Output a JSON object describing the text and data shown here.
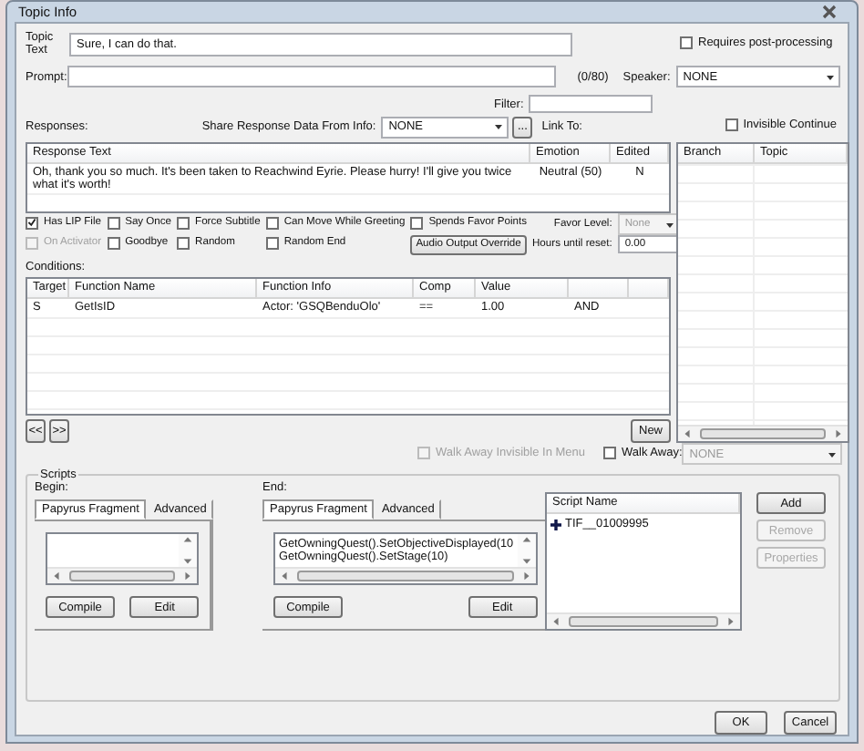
{
  "window": {
    "title": "Topic Info"
  },
  "topic_text": {
    "label": "Topic Text",
    "value": "Sure, I can do that."
  },
  "requires_post_processing": {
    "label": "Requires post-processing",
    "checked": false
  },
  "prompt": {
    "label": "Prompt:",
    "counter": "(0/80)"
  },
  "speaker": {
    "label": "Speaker:",
    "value": "NONE"
  },
  "filter": {
    "label": "Filter:"
  },
  "responses": {
    "label": "Responses:",
    "share_label": "Share Response Data From Info:",
    "share_value": "NONE",
    "browse_button": "...",
    "columns": [
      "Response Text",
      "Emotion",
      "Edited"
    ],
    "rows": [
      [
        "Oh, thank you so much. It's been taken to Reachwind Eyrie. Please hurry! I'll give you twice what it's worth!",
        "Neutral (50)",
        "N"
      ]
    ]
  },
  "link_to": {
    "label": "Link To:",
    "invisible_continue": {
      "label": "Invisible Continue",
      "checked": false
    },
    "columns": [
      "Branch",
      "Topic"
    ]
  },
  "flags": [
    [
      {
        "label": "Has LIP File",
        "checked": true,
        "disabled": false
      },
      {
        "label": "Say Once",
        "checked": false,
        "disabled": false
      },
      {
        "label": "Force Subtitle",
        "checked": false,
        "disabled": false
      },
      {
        "label": "Can Move While Greeting",
        "checked": false,
        "disabled": false
      },
      {
        "label": "Spends Favor Points",
        "checked": false,
        "disabled": false
      }
    ],
    [
      {
        "label": "On Activator",
        "checked": false,
        "disabled": true
      },
      {
        "label": "Goodbye",
        "checked": false,
        "disabled": false
      },
      {
        "label": "Random",
        "checked": false,
        "disabled": false
      },
      {
        "label": "Random End",
        "checked": false,
        "disabled": false
      }
    ]
  ],
  "favor_level": {
    "label": "Favor Level:",
    "value": "None",
    "disabled": true
  },
  "audio_override_button": "Audio Output Override",
  "hours_until_reset": {
    "label": "Hours until reset:",
    "value": "0.00"
  },
  "conditions": {
    "label": "Conditions:",
    "columns": [
      "Target",
      "Function Name",
      "Function Info",
      "Comp",
      "Value"
    ],
    "rows": [
      [
        "S",
        "GetIsID",
        "Actor: 'GSQBenduOlo'",
        "==",
        "1.00",
        "AND"
      ]
    ]
  },
  "nav_buttons": [
    "<<",
    ">>"
  ],
  "new_button": "New",
  "walk_away_invisible": {
    "label": "Walk Away Invisible In Menu",
    "checked": false,
    "disabled": true
  },
  "walk_away": {
    "label": "Walk Away:",
    "checked": false,
    "value": "NONE",
    "disabled": true
  },
  "scripts": {
    "title": "Scripts",
    "panels": [
      {
        "label": "Begin:",
        "tabs": [
          {
            "label": "Papyrus Fragment",
            "selected": true
          },
          {
            "label": "Advanced",
            "selected": false
          }
        ],
        "buttons": [
          "Compile",
          "Edit"
        ]
      },
      {
        "label": "End:",
        "tabs": [
          {
            "label": "Papyrus Fragment",
            "selected": true
          },
          {
            "label": "Advanced",
            "selected": false
          }
        ],
        "lines": [
          "GetOwningQuest().SetObjectiveDisplayed(10",
          "GetOwningQuest().SetStage(10)"
        ],
        "buttons": [
          "Compile",
          "Edit"
        ]
      }
    ],
    "script_list": {
      "column": "Script Name",
      "items": [
        {
          "name": "TIF__01009995"
        }
      ]
    },
    "buttons": [
      {
        "label": "Add",
        "disabled": false
      },
      {
        "label": "Remove",
        "disabled": true
      },
      {
        "label": "Properties",
        "disabled": true
      }
    ]
  },
  "footer_buttons": [
    "OK",
    "Cancel"
  ]
}
